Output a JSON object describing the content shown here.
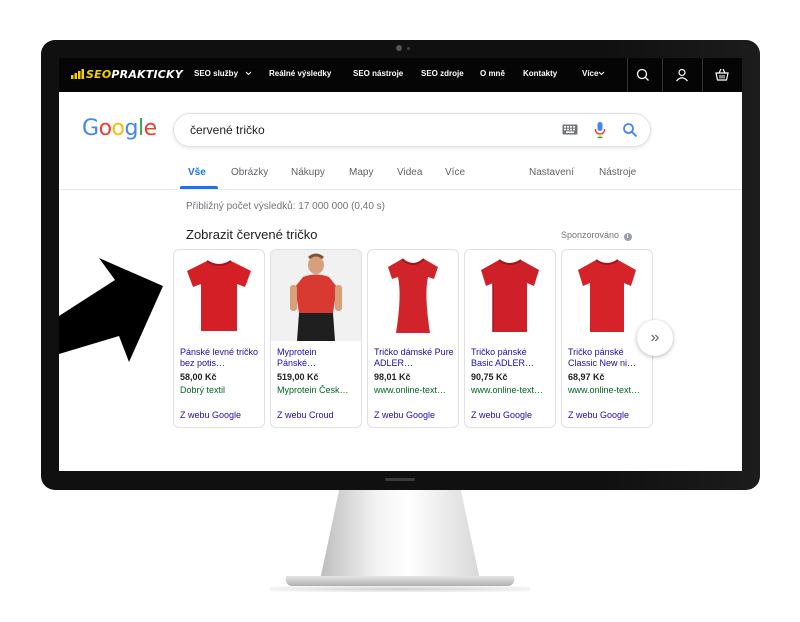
{
  "site_nav": {
    "logo_prefix": "SEO",
    "logo_rest": "PRAKTICKY",
    "items": [
      {
        "label": "SEO služby",
        "has_dropdown": true
      },
      {
        "label": "Reálné výsledky"
      },
      {
        "label": "SEO nástroje"
      },
      {
        "label": "SEO zdroje"
      },
      {
        "label": "O mně"
      },
      {
        "label": "Kontakty"
      },
      {
        "label": "Více",
        "has_dropdown": true
      }
    ],
    "icons": [
      "search-icon",
      "user-icon",
      "basket-icon"
    ]
  },
  "google": {
    "logo_letters": [
      "G",
      "o",
      "o",
      "g",
      "l",
      "e"
    ],
    "logo_colors": [
      "#4285F4",
      "#EA4335",
      "#FBBC05",
      "#4285F4",
      "#34A853",
      "#EA4335"
    ],
    "search_value": "červené tričko",
    "tabs": [
      {
        "label": "Vše",
        "active": true
      },
      {
        "label": "Obrázky"
      },
      {
        "label": "Nákupy"
      },
      {
        "label": "Mapy"
      },
      {
        "label": "Videa"
      },
      {
        "label": "Více"
      },
      {
        "label": "Nastavení"
      },
      {
        "label": "Nástroje"
      }
    ],
    "results_count": "Přibližný počet výsledků: 17 000 000 (0,40 s)",
    "shopping": {
      "title": "Zobrazit červené tričko",
      "sponsored": "Sponzorováno",
      "info_glyph": "i",
      "next_glyph": "»",
      "products": [
        {
          "title": "Pánské levné tričko bez potis…",
          "price": "58,00 Kč",
          "store": "Dobrý textil",
          "from": "Z webu Google"
        },
        {
          "title": "Myprotein Pánské…",
          "price": "519,00 Kč",
          "store": "Myprotein Česk…",
          "from": "Z webu Croud"
        },
        {
          "title": "Tričko dámské Pure ADLER…",
          "price": "98,01 Kč",
          "store": "www.online-text…",
          "from": "Z webu Google"
        },
        {
          "title": "Tričko pánské Basic ADLER…",
          "price": "90,75 Kč",
          "store": "www.online-text…",
          "from": "Z webu Google"
        },
        {
          "title": "Tričko pánské Classic New ni…",
          "price": "68,97 Kč",
          "store": "www.online-text…",
          "from": "Z webu Google"
        }
      ]
    }
  },
  "colors": {
    "nav_bg": "#050505",
    "logo_accent": "#f5d000",
    "link_blue": "#1a0dab",
    "tab_active": "#1a73e8",
    "store_green": "#006621",
    "shirt_red": "#d41f26"
  }
}
